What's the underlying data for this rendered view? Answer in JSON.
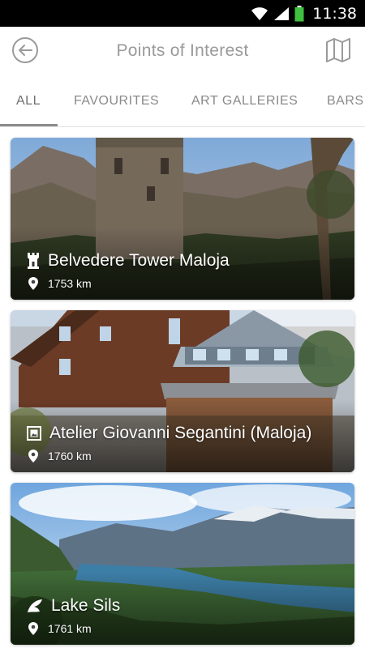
{
  "status_bar": {
    "time": "11:38",
    "icons": [
      "wifi-icon",
      "signal-icon",
      "battery-icon"
    ],
    "battery_color": "#3fbf3f"
  },
  "header": {
    "title": "Points of Interest",
    "back_icon": "back-arrow-icon",
    "map_icon": "map-icon"
  },
  "tabs": [
    {
      "label": "ALL",
      "selected": true
    },
    {
      "label": "FAVOURITES",
      "selected": false
    },
    {
      "label": "ART GALLERIES",
      "selected": false
    },
    {
      "label": "BARS",
      "selected": false
    }
  ],
  "places": [
    {
      "name": "Belvedere Tower Maloja",
      "distance": "1753 km",
      "category_icon": "tower-icon",
      "location_icon": "location-pin-icon"
    },
    {
      "name": "Atelier Giovanni Segantini (Maloja)",
      "distance": "1760 km",
      "category_icon": "gallery-icon",
      "location_icon": "location-pin-icon"
    },
    {
      "name": "Lake Sils",
      "distance": "1761 km",
      "category_icon": "leaf-icon",
      "location_icon": "location-pin-icon"
    }
  ],
  "colors": {
    "header_text": "#9a9a9a",
    "tab_text": "#8a8a8a",
    "tab_indicator": "#8c8c8c"
  }
}
